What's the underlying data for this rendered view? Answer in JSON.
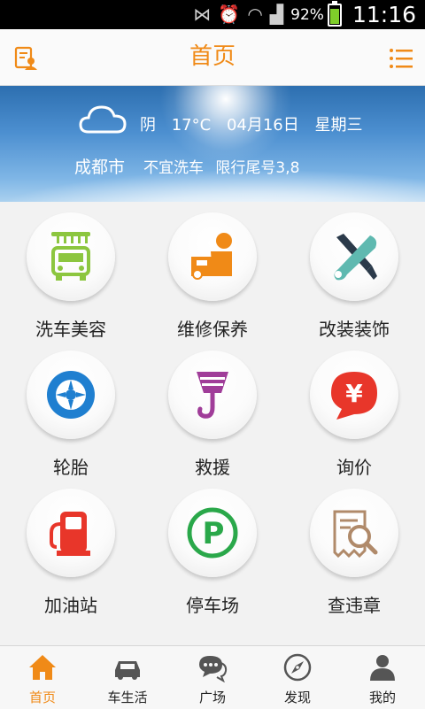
{
  "status_bar": {
    "battery_percent": "92%",
    "time": "11:16"
  },
  "header": {
    "title": "首页",
    "left_icon": "profile-doc-icon",
    "right_icon": "list-menu-icon"
  },
  "weather": {
    "condition": "阴",
    "temperature": "17°C",
    "date": "04月16日",
    "weekday": "星期三",
    "city": "成都市",
    "wash_advice": "不宜洗车",
    "restriction": "限行尾号3,8"
  },
  "grid": {
    "items": [
      {
        "label": "洗车美容",
        "icon": "car-wash-icon"
      },
      {
        "label": "维修保养",
        "icon": "repair-maintenance-icon"
      },
      {
        "label": "改装装饰",
        "icon": "tools-icon"
      },
      {
        "label": "轮胎",
        "icon": "tire-icon"
      },
      {
        "label": "救援",
        "icon": "tow-hook-icon"
      },
      {
        "label": "询价",
        "icon": "yuan-price-icon"
      },
      {
        "label": "加油站",
        "icon": "fuel-pump-icon"
      },
      {
        "label": "停车场",
        "icon": "parking-icon"
      },
      {
        "label": "查违章",
        "icon": "violation-search-icon"
      }
    ]
  },
  "bottom_nav": {
    "tabs": [
      {
        "label": "首页",
        "icon": "home-icon",
        "active": true
      },
      {
        "label": "车生活",
        "icon": "car-life-icon",
        "active": false
      },
      {
        "label": "广场",
        "icon": "chat-bubbles-icon",
        "active": false
      },
      {
        "label": "发现",
        "icon": "compass-icon",
        "active": false
      },
      {
        "label": "我的",
        "icon": "user-icon",
        "active": false
      }
    ]
  },
  "colors": {
    "accent": "#f08a17",
    "blue": "#1f7fd0",
    "green": "#8cc63f",
    "red": "#e8362a",
    "purple": "#a03d99",
    "parking_green": "#2aa84a"
  }
}
